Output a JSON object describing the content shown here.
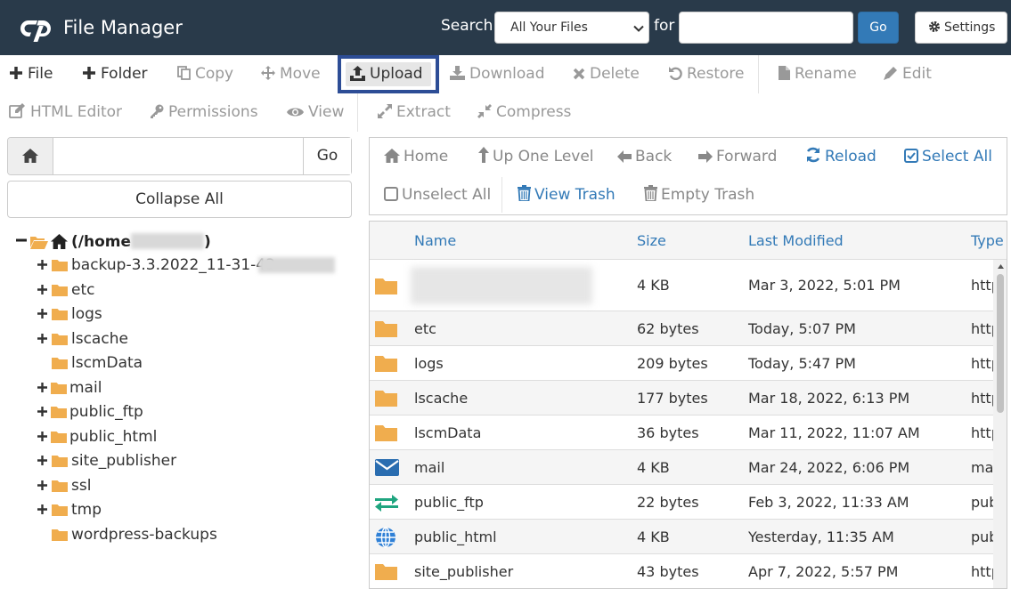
{
  "header": {
    "title": "File Manager",
    "search_label": "Search",
    "search_scope": "All Your Files",
    "for_label": "for",
    "search_value": "",
    "go_label": "Go",
    "settings_label": "Settings"
  },
  "toolbar": {
    "row1": [
      {
        "key": "file",
        "label": "File",
        "icon": "plus-icon",
        "enabled": true
      },
      {
        "key": "folder",
        "label": "Folder",
        "icon": "plus-icon",
        "enabled": true
      },
      {
        "key": "copy",
        "label": "Copy",
        "icon": "copy-icon",
        "enabled": false
      },
      {
        "key": "move",
        "label": "Move",
        "icon": "move-arrows-icon",
        "enabled": false
      },
      {
        "key": "upload",
        "label": "Upload",
        "icon": "upload-icon",
        "enabled": true
      },
      {
        "key": "download",
        "label": "Download",
        "icon": "download-icon",
        "enabled": false
      },
      {
        "key": "delete",
        "label": "Delete",
        "icon": "x-icon",
        "enabled": false
      },
      {
        "key": "restore",
        "label": "Restore",
        "icon": "undo-icon",
        "enabled": false
      },
      {
        "key": "rename",
        "label": "Rename",
        "icon": "file-icon",
        "enabled": false
      },
      {
        "key": "edit",
        "label": "Edit",
        "icon": "pencil-icon",
        "enabled": false
      }
    ],
    "row2": [
      {
        "key": "html-editor",
        "label": "HTML Editor",
        "icon": "edit-square-icon",
        "enabled": false
      },
      {
        "key": "permissions",
        "label": "Permissions",
        "icon": "key-icon",
        "enabled": false
      },
      {
        "key": "view",
        "label": "View",
        "icon": "eye-icon",
        "enabled": false
      },
      {
        "key": "extract",
        "label": "Extract",
        "icon": "expand-icon",
        "enabled": false
      },
      {
        "key": "compress",
        "label": "Compress",
        "icon": "compress-icon",
        "enabled": false
      }
    ]
  },
  "left_panel": {
    "path_value": "",
    "go_label": "Go",
    "collapse_label": "Collapse All",
    "root_label": "(/home",
    "root_close": ")",
    "tree": [
      {
        "label": "backup-3.3.2022_11-31-43",
        "expandable": true
      },
      {
        "label": "etc",
        "expandable": true
      },
      {
        "label": "logs",
        "expandable": true
      },
      {
        "label": "lscache",
        "expandable": true
      },
      {
        "label": "lscmData",
        "expandable": false
      },
      {
        "label": "mail",
        "expandable": true
      },
      {
        "label": "public_ftp",
        "expandable": true
      },
      {
        "label": "public_html",
        "expandable": true
      },
      {
        "label": "site_publisher",
        "expandable": true
      },
      {
        "label": "ssl",
        "expandable": true
      },
      {
        "label": "tmp",
        "expandable": true
      },
      {
        "label": "wordpress-backups",
        "expandable": false
      }
    ]
  },
  "nav": {
    "home": "Home",
    "up": "Up One Level",
    "back": "Back",
    "forward": "Forward",
    "reload": "Reload",
    "select_all": "Select All",
    "unselect_all": "Unselect All",
    "view_trash": "View Trash",
    "empty_trash": "Empty Trash"
  },
  "table": {
    "columns": [
      "Name",
      "Size",
      "Last Modified",
      "Type"
    ],
    "rows": [
      {
        "icon": "folder-icon",
        "name": "",
        "size": "4 KB",
        "modified": "Mar 3, 2022, 5:01 PM",
        "type": "http"
      },
      {
        "icon": "folder-icon",
        "name": "etc",
        "size": "62 bytes",
        "modified": "Today, 5:07 PM",
        "type": "http"
      },
      {
        "icon": "folder-icon",
        "name": "logs",
        "size": "209 bytes",
        "modified": "Today, 5:47 PM",
        "type": "http"
      },
      {
        "icon": "folder-icon",
        "name": "lscache",
        "size": "177 bytes",
        "modified": "Mar 18, 2022, 6:13 PM",
        "type": "http"
      },
      {
        "icon": "folder-icon",
        "name": "lscmData",
        "size": "36 bytes",
        "modified": "Mar 11, 2022, 11:07 AM",
        "type": "http"
      },
      {
        "icon": "mail-icon",
        "name": "mail",
        "size": "4 KB",
        "modified": "Mar 24, 2022, 6:06 PM",
        "type": "ma"
      },
      {
        "icon": "transfer-arrows-icon",
        "name": "public_ftp",
        "size": "22 bytes",
        "modified": "Feb 3, 2022, 11:33 AM",
        "type": "pub"
      },
      {
        "icon": "globe-icon",
        "name": "public_html",
        "size": "4 KB",
        "modified": "Yesterday, 11:35 AM",
        "type": "pub"
      },
      {
        "icon": "folder-icon",
        "name": "site_publisher",
        "size": "43 bytes",
        "modified": "Apr 7, 2022, 5:57 PM",
        "type": "http"
      }
    ]
  },
  "colors": {
    "header_bg": "#293a4a",
    "accent": "#337ab7",
    "folder": "#f0ad4e",
    "upload_highlight": "#2d4d96"
  }
}
